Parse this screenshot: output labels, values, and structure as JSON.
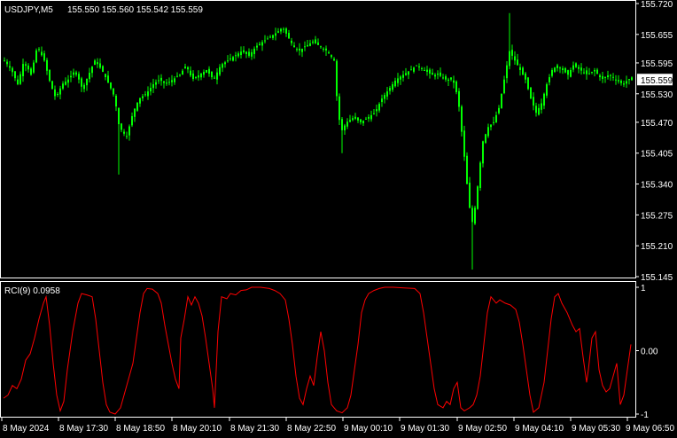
{
  "header": {
    "symbol": "USDJPY,M5",
    "ohlc": "155.550 155.560 155.542 155.559"
  },
  "indicator": {
    "name": "RCI(9) 0.0958"
  },
  "colors": {
    "background": "#000000",
    "grid_border": "#ffffff",
    "candle": "#00ff00",
    "rci_line": "#ff0000",
    "price_tag_bg": "#ffffff",
    "price_tag_text": "#000000"
  },
  "chart_data": [
    {
      "type": "candlestick",
      "title": "USDJPY,M5",
      "ylim": [
        155.145,
        155.72
      ],
      "y_ticks": [
        "155.720",
        "155.655",
        "155.595",
        "155.530",
        "155.470",
        "155.405",
        "155.340",
        "155.275",
        "155.210",
        "155.145"
      ],
      "y_tick_values": [
        155.72,
        155.655,
        155.595,
        155.53,
        155.47,
        155.405,
        155.34,
        155.275,
        155.21,
        155.145
      ],
      "current_price": "155.559",
      "current_price_value": 155.559,
      "close_path": [
        [
          0,
          155.6
        ],
        [
          8,
          155.58
        ],
        [
          15,
          155.55
        ],
        [
          22,
          155.6
        ],
        [
          30,
          155.57
        ],
        [
          37,
          155.63
        ],
        [
          45,
          155.6
        ],
        [
          52,
          155.55
        ],
        [
          58,
          155.52
        ],
        [
          65,
          155.55
        ],
        [
          72,
          155.56
        ],
        [
          80,
          155.58
        ],
        [
          88,
          155.54
        ],
        [
          95,
          155.57
        ],
        [
          102,
          155.6
        ],
        [
          110,
          155.58
        ],
        [
          118,
          155.55
        ],
        [
          125,
          155.52
        ],
        [
          128,
          155.47
        ],
        [
          133,
          155.45
        ],
        [
          138,
          155.44
        ],
        [
          145,
          155.49
        ],
        [
          152,
          155.52
        ],
        [
          160,
          155.53
        ],
        [
          168,
          155.55
        ],
        [
          175,
          155.56
        ],
        [
          182,
          155.55
        ],
        [
          190,
          155.56
        ],
        [
          198,
          155.57
        ],
        [
          205,
          155.59
        ],
        [
          212,
          155.56
        ],
        [
          220,
          155.57
        ],
        [
          228,
          155.58
        ],
        [
          236,
          155.56
        ],
        [
          244,
          155.59
        ],
        [
          252,
          155.6
        ],
        [
          260,
          155.61
        ],
        [
          268,
          155.62
        ],
        [
          276,
          155.61
        ],
        [
          284,
          155.63
        ],
        [
          292,
          155.64
        ],
        [
          300,
          155.65
        ],
        [
          308,
          155.66
        ],
        [
          314,
          155.67
        ],
        [
          320,
          155.65
        ],
        [
          326,
          155.63
        ],
        [
          332,
          155.62
        ],
        [
          340,
          155.63
        ],
        [
          348,
          155.64
        ],
        [
          356,
          155.63
        ],
        [
          364,
          155.62
        ],
        [
          372,
          155.6
        ],
        [
          376,
          155.5
        ],
        [
          380,
          155.45
        ],
        [
          386,
          155.47
        ],
        [
          394,
          155.48
        ],
        [
          402,
          155.47
        ],
        [
          410,
          155.48
        ],
        [
          418,
          155.49
        ],
        [
          426,
          155.52
        ],
        [
          434,
          155.54
        ],
        [
          442,
          155.56
        ],
        [
          450,
          155.57
        ],
        [
          458,
          155.58
        ],
        [
          466,
          155.59
        ],
        [
          474,
          155.58
        ],
        [
          482,
          155.57
        ],
        [
          490,
          155.57
        ],
        [
          498,
          155.56
        ],
        [
          506,
          155.56
        ],
        [
          512,
          155.52
        ],
        [
          516,
          155.45
        ],
        [
          520,
          155.38
        ],
        [
          524,
          155.3
        ],
        [
          528,
          155.26
        ],
        [
          532,
          155.3
        ],
        [
          536,
          155.37
        ],
        [
          540,
          155.43
        ],
        [
          546,
          155.46
        ],
        [
          552,
          155.47
        ],
        [
          558,
          155.5
        ],
        [
          564,
          155.56
        ],
        [
          570,
          155.62
        ],
        [
          576,
          155.6
        ],
        [
          582,
          155.58
        ],
        [
          588,
          155.56
        ],
        [
          594,
          155.52
        ],
        [
          600,
          155.49
        ],
        [
          606,
          155.51
        ],
        [
          612,
          155.55
        ],
        [
          618,
          155.58
        ],
        [
          624,
          155.59
        ],
        [
          630,
          155.58
        ],
        [
          636,
          155.57
        ],
        [
          642,
          155.59
        ],
        [
          650,
          155.58
        ],
        [
          658,
          155.57
        ],
        [
          666,
          155.58
        ],
        [
          674,
          155.56
        ],
        [
          682,
          155.57
        ],
        [
          690,
          155.56
        ],
        [
          698,
          155.55
        ],
        [
          704,
          155.56
        ],
        [
          708,
          155.559
        ]
      ],
      "spikes": [
        {
          "at": 128,
          "low": 155.36
        },
        {
          "at": 380,
          "low": 155.405
        },
        {
          "at": 528,
          "low": 155.16
        },
        {
          "at": 570,
          "high": 155.7
        },
        {
          "at": 316,
          "high": 155.67
        }
      ]
    },
    {
      "type": "line",
      "title": "RCI(9) 0.0958",
      "ylim": [
        -1,
        1
      ],
      "y_ticks": [
        "1",
        "0.00",
        "-1"
      ],
      "y_tick_values": [
        1,
        0,
        -1
      ],
      "x_ticks": [
        "8 May 2024",
        "8 May 17:30",
        "8 May 18:50",
        "8 May 20:10",
        "8 May 21:30",
        "8 May 22:50",
        "9 May 00:10",
        "9 May 01:30",
        "9 May 02:50",
        "9 May 04:10",
        "9 May 05:30",
        "9 May 06:50"
      ],
      "series": [
        {
          "values": [
            [
              0,
              -0.75
            ],
            [
              5,
              -0.7
            ],
            [
              10,
              -0.55
            ],
            [
              15,
              -0.6
            ],
            [
              20,
              -0.45
            ],
            [
              25,
              -0.15
            ],
            [
              30,
              -0.05
            ],
            [
              35,
              0.2
            ],
            [
              40,
              0.5
            ],
            [
              45,
              0.75
            ],
            [
              48,
              0.85
            ],
            [
              52,
              0.4
            ],
            [
              56,
              -0.2
            ],
            [
              60,
              -0.7
            ],
            [
              64,
              -0.95
            ],
            [
              68,
              -0.8
            ],
            [
              72,
              -0.3
            ],
            [
              78,
              0.3
            ],
            [
              84,
              0.75
            ],
            [
              88,
              0.9
            ],
            [
              94,
              0.88
            ],
            [
              100,
              0.85
            ],
            [
              104,
              0.5
            ],
            [
              108,
              0.0
            ],
            [
              112,
              -0.5
            ],
            [
              116,
              -0.85
            ],
            [
              120,
              -0.97
            ],
            [
              126,
              -1.0
            ],
            [
              132,
              -0.9
            ],
            [
              136,
              -0.7
            ],
            [
              140,
              -0.5
            ],
            [
              146,
              -0.2
            ],
            [
              150,
              0.2
            ],
            [
              154,
              0.6
            ],
            [
              158,
              0.9
            ],
            [
              162,
              0.98
            ],
            [
              168,
              0.97
            ],
            [
              174,
              0.9
            ],
            [
              178,
              0.75
            ],
            [
              182,
              0.4
            ],
            [
              186,
              0.1
            ],
            [
              190,
              -0.2
            ],
            [
              194,
              -0.45
            ],
            [
              198,
              -0.6
            ],
            [
              200,
              0.2
            ],
            [
              204,
              0.5
            ],
            [
              208,
              0.85
            ],
            [
              212,
              0.72
            ],
            [
              216,
              0.85
            ],
            [
              220,
              0.75
            ],
            [
              224,
              0.55
            ],
            [
              228,
              0.2
            ],
            [
              232,
              -0.2
            ],
            [
              236,
              -0.6
            ],
            [
              238,
              -0.9
            ],
            [
              242,
              0.3
            ],
            [
              246,
              0.85
            ],
            [
              252,
              0.82
            ],
            [
              256,
              0.9
            ],
            [
              262,
              0.88
            ],
            [
              268,
              0.95
            ],
            [
              274,
              0.96
            ],
            [
              280,
              1.0
            ],
            [
              290,
              1.0
            ],
            [
              300,
              0.98
            ],
            [
              306,
              0.95
            ],
            [
              312,
              0.9
            ],
            [
              318,
              0.8
            ],
            [
              322,
              0.5
            ],
            [
              326,
              0.1
            ],
            [
              330,
              -0.4
            ],
            [
              334,
              -0.75
            ],
            [
              338,
              -0.85
            ],
            [
              342,
              -0.6
            ],
            [
              346,
              -0.4
            ],
            [
              350,
              -0.55
            ],
            [
              354,
              -0.1
            ],
            [
              358,
              0.3
            ],
            [
              362,
              0.0
            ],
            [
              366,
              -0.5
            ],
            [
              370,
              -0.85
            ],
            [
              376,
              -0.95
            ],
            [
              382,
              -0.98
            ],
            [
              388,
              -0.9
            ],
            [
              392,
              -0.7
            ],
            [
              396,
              -0.3
            ],
            [
              400,
              0.1
            ],
            [
              404,
              0.6
            ],
            [
              408,
              0.8
            ],
            [
              412,
              0.9
            ],
            [
              418,
              0.95
            ],
            [
              424,
              0.98
            ],
            [
              430,
              1.0
            ],
            [
              440,
              1.0
            ],
            [
              452,
              0.99
            ],
            [
              464,
              0.98
            ],
            [
              470,
              0.9
            ],
            [
              474,
              0.6
            ],
            [
              478,
              0.2
            ],
            [
              482,
              -0.2
            ],
            [
              486,
              -0.6
            ],
            [
              490,
              -0.85
            ],
            [
              496,
              -0.9
            ],
            [
              500,
              -0.8
            ],
            [
              504,
              -0.85
            ],
            [
              508,
              -0.6
            ],
            [
              512,
              -0.5
            ],
            [
              516,
              -0.9
            ],
            [
              520,
              -0.95
            ],
            [
              526,
              -0.9
            ],
            [
              530,
              -0.85
            ],
            [
              534,
              -0.7
            ],
            [
              538,
              -0.4
            ],
            [
              542,
              0.1
            ],
            [
              546,
              0.6
            ],
            [
              550,
              0.85
            ],
            [
              556,
              0.75
            ],
            [
              560,
              0.8
            ],
            [
              566,
              0.75
            ],
            [
              572,
              0.72
            ],
            [
              578,
              0.65
            ],
            [
              582,
              0.45
            ],
            [
              586,
              0.1
            ],
            [
              590,
              -0.3
            ],
            [
              594,
              -0.7
            ],
            [
              598,
              -0.97
            ],
            [
              604,
              -0.9
            ],
            [
              610,
              -0.5
            ],
            [
              614,
              0.0
            ],
            [
              618,
              0.5
            ],
            [
              622,
              0.85
            ],
            [
              626,
              0.9
            ],
            [
              630,
              0.75
            ],
            [
              636,
              0.6
            ],
            [
              642,
              0.4
            ],
            [
              646,
              0.3
            ],
            [
              650,
              0.35
            ],
            [
              654,
              -0.1
            ],
            [
              658,
              -0.5
            ],
            [
              660,
              -0.3
            ],
            [
              664,
              0.2
            ],
            [
              668,
              0.3
            ],
            [
              672,
              -0.3
            ],
            [
              676,
              -0.55
            ],
            [
              680,
              -0.65
            ],
            [
              684,
              -0.6
            ],
            [
              688,
              -0.4
            ],
            [
              692,
              -0.2
            ],
            [
              696,
              -0.85
            ],
            [
              700,
              -0.7
            ],
            [
              704,
              -0.3
            ],
            [
              708,
              0.1
            ]
          ]
        }
      ]
    }
  ]
}
